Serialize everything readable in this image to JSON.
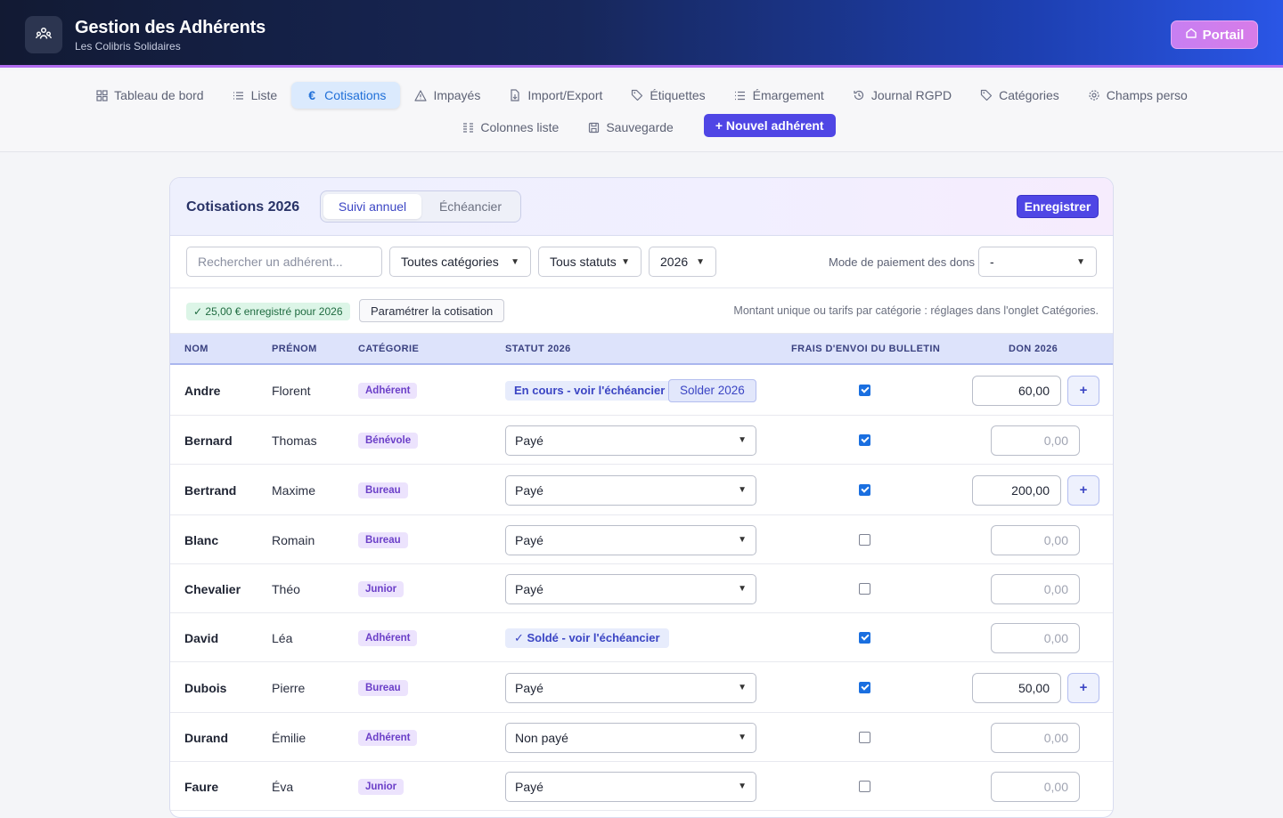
{
  "header": {
    "title": "Gestion des Adhérents",
    "subtitle": "Les Colibris Solidaires",
    "portal_label": "Portail"
  },
  "nav": {
    "row1": [
      {
        "label": "Tableau de bord",
        "icon": "dashboard-icon"
      },
      {
        "label": "Liste",
        "icon": "list-icon"
      },
      {
        "label": "Cotisations",
        "icon": "euro-icon",
        "active": true
      },
      {
        "label": "Impayés",
        "icon": "warning-icon"
      },
      {
        "label": "Import/Export",
        "icon": "file-transfer-icon"
      },
      {
        "label": "Étiquettes",
        "icon": "tag-icon"
      },
      {
        "label": "Émargement",
        "icon": "checklist-icon"
      },
      {
        "label": "Journal RGPD",
        "icon": "history-icon"
      },
      {
        "label": "Catégories",
        "icon": "tag-icon"
      },
      {
        "label": "Champs perso",
        "icon": "gear-icon"
      }
    ],
    "row2": [
      {
        "label": "Colonnes liste",
        "icon": "columns-icon"
      },
      {
        "label": "Sauvegarde",
        "icon": "save-icon"
      }
    ],
    "new_member_label": "+ Nouvel adhérent"
  },
  "card": {
    "title": "Cotisations 2026",
    "tab_annual": "Suivi annuel",
    "tab_schedule": "Échéancier",
    "save_label": "Enregistrer"
  },
  "filters": {
    "search_placeholder": "Rechercher un adhérent...",
    "category": "Toutes catégories",
    "status": "Tous statuts",
    "year": "2026",
    "don_mode_label": "Mode de paiement des dons",
    "don_mode_value": "-"
  },
  "info": {
    "badge": "✓ 25,00 € enregistré pour 2026",
    "param_button": "Paramétrer la cotisation",
    "note": "Montant unique ou tarifs par catégorie : réglages dans l'onglet Catégories."
  },
  "columns": {
    "nom": "NOM",
    "prenom": "PRÉNOM",
    "categorie": "CATÉGORIE",
    "statut": "STATUT 2026",
    "frais": "FRAIS D'ENVOI DU BULLETIN",
    "don": "DON 2026"
  },
  "rows": [
    {
      "nom": "Andre",
      "prenom": "Florent",
      "categorie": "Adhérent",
      "status_type": "link",
      "status": "En cours - voir l'échéancier",
      "solder": "Solder 2026",
      "frais": true,
      "don": "60,00",
      "has_plus": true
    },
    {
      "nom": "Bernard",
      "prenom": "Thomas",
      "categorie": "Bénévole",
      "status_type": "select",
      "status": "Payé",
      "frais": true,
      "don": "0,00",
      "has_plus": false
    },
    {
      "nom": "Bertrand",
      "prenom": "Maxime",
      "categorie": "Bureau",
      "status_type": "select",
      "status": "Payé",
      "frais": true,
      "don": "200,00",
      "has_plus": true
    },
    {
      "nom": "Blanc",
      "prenom": "Romain",
      "categorie": "Bureau",
      "status_type": "select",
      "status": "Payé",
      "frais": false,
      "don": "0,00",
      "has_plus": false
    },
    {
      "nom": "Chevalier",
      "prenom": "Théo",
      "categorie": "Junior",
      "status_type": "select",
      "status": "Payé",
      "frais": false,
      "don": "0,00",
      "has_plus": false
    },
    {
      "nom": "David",
      "prenom": "Léa",
      "categorie": "Adhérent",
      "status_type": "link",
      "status": "✓ Soldé - voir l'échéancier",
      "frais": true,
      "don": "0,00",
      "has_plus": false
    },
    {
      "nom": "Dubois",
      "prenom": "Pierre",
      "categorie": "Bureau",
      "status_type": "select",
      "status": "Payé",
      "frais": true,
      "don": "50,00",
      "has_plus": true
    },
    {
      "nom": "Durand",
      "prenom": "Émilie",
      "categorie": "Adhérent",
      "status_type": "select",
      "status": "Non payé",
      "frais": false,
      "don": "0,00",
      "has_plus": false
    },
    {
      "nom": "Faure",
      "prenom": "Éva",
      "categorie": "Junior",
      "status_type": "select",
      "status": "Payé",
      "frais": false,
      "don": "0,00",
      "has_plus": false
    }
  ],
  "colors": {
    "accent": "#4f46e5",
    "header_start": "#121a33",
    "header_end": "#2a56e6",
    "portal": "#c77ff2",
    "category_badge": "#ece3fd"
  }
}
